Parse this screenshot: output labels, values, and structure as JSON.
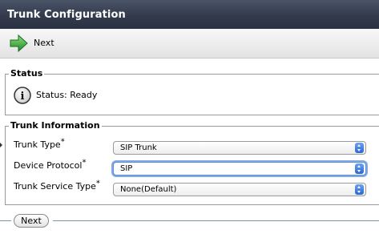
{
  "header": {
    "title": "Trunk Configuration"
  },
  "toolbar": {
    "next_label": "Next",
    "next_icon": "green-arrow-right-icon"
  },
  "status_section": {
    "legend": "Status",
    "icon": "info-icon",
    "text": "Status: Ready"
  },
  "trunk_info": {
    "legend": "Trunk Information",
    "required_marker": "*",
    "fields": [
      {
        "label": "Trunk Type",
        "value": "SIP Trunk"
      },
      {
        "label": "Device Protocol",
        "value": "SIP"
      },
      {
        "label": "Trunk Service Type",
        "value": "None(Default)"
      }
    ]
  },
  "footer": {
    "next_button_label": "Next"
  },
  "colors": {
    "titlebar": "#333b4c",
    "arrow_green": "#2fa23a",
    "focus_ring": "#7fa9e8"
  }
}
